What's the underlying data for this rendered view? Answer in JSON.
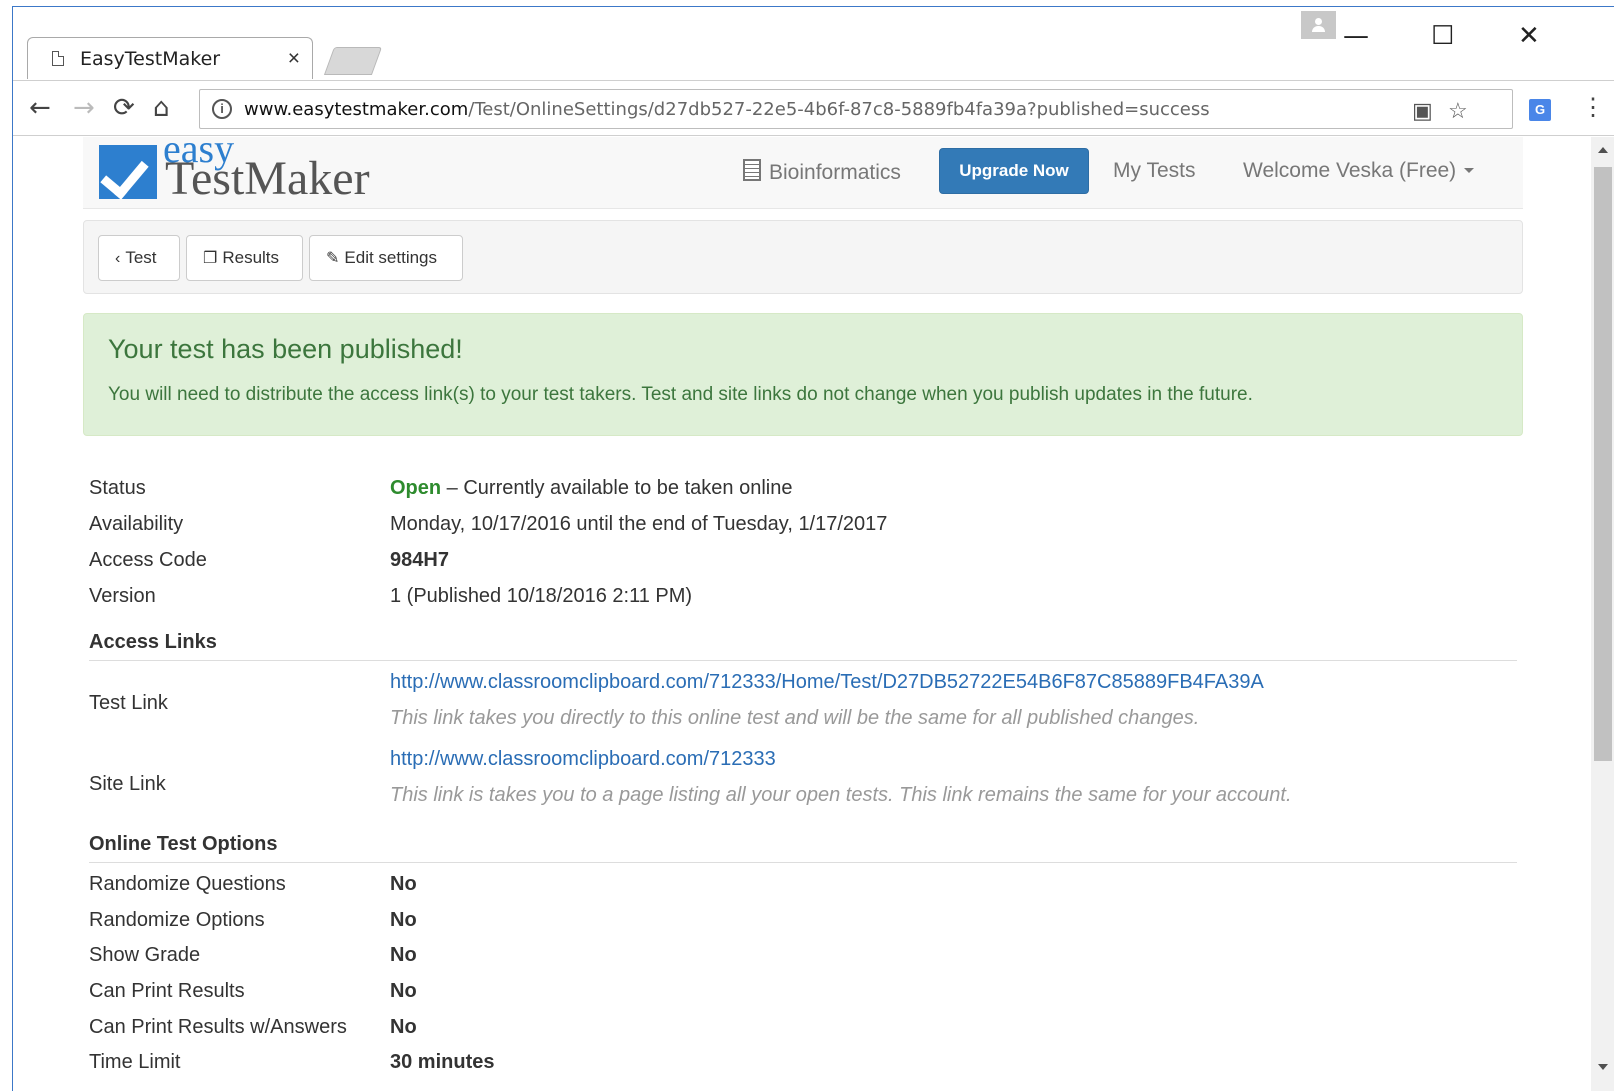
{
  "browser": {
    "tab_title": "EasyTestMaker",
    "tab_close": "×",
    "url_host": "www.easytestmaker.com",
    "url_path": "/Test/OnlineSettings/d27db527-22e5-4b6f-87c8-5889fb4fa39a?published=success",
    "controls": {
      "minimize": "—",
      "maximize": "☐",
      "close": "✕"
    },
    "nav": {
      "back": "←",
      "forward": "→",
      "reload": "⟳",
      "home": "⌂"
    },
    "info_icon": "i",
    "translate_icon": "G",
    "menu": "⋮"
  },
  "site": {
    "logo_top": "easy",
    "logo_bottom": "TestMaker",
    "nav": {
      "bioinformatics": "Bioinformatics",
      "upgrade": "Upgrade Now",
      "my_tests": "My Tests",
      "welcome": "Welcome Veska (Free)"
    }
  },
  "actions": {
    "back": "Test",
    "results": "Results",
    "edit": "Edit settings"
  },
  "alert": {
    "title": "Your test has been published!",
    "message": "You will need to distribute the access link(s) to your test takers. Test and site links do not change when you publish updates in the future."
  },
  "details": {
    "status_label": "Status",
    "status_value": "Open",
    "status_desc": " – Currently available to be taken online",
    "availability_label": "Availability",
    "availability_value": "Monday, 10/17/2016 until the end of Tuesday, 1/17/2017",
    "access_code_label": "Access Code",
    "access_code_value": "984H7",
    "version_label": "Version",
    "version_value": "1 (Published 10/18/2016 2:11 PM)"
  },
  "access_links": {
    "heading": "Access Links",
    "test_link_label": "Test Link",
    "test_link_url": "http://www.classroomclipboard.com/712333/Home/Test/D27DB52722E54B6F87C85889FB4FA39A",
    "test_link_hint": "This link takes you directly to this online test and will be the same for all published changes.",
    "site_link_label": "Site Link",
    "site_link_url": "http://www.classroomclipboard.com/712333",
    "site_link_hint": "This link is takes you to a page listing all your open tests. This link remains the same for your account."
  },
  "options": {
    "heading": "Online Test Options",
    "items": [
      {
        "label": "Randomize Questions",
        "value": "No"
      },
      {
        "label": "Randomize Options",
        "value": "No"
      },
      {
        "label": "Show Grade",
        "value": "No"
      },
      {
        "label": "Can Print Results",
        "value": "No"
      },
      {
        "label": "Can Print Results w/Answers",
        "value": "No"
      },
      {
        "label": "Time Limit",
        "value": "30 minutes"
      }
    ]
  }
}
